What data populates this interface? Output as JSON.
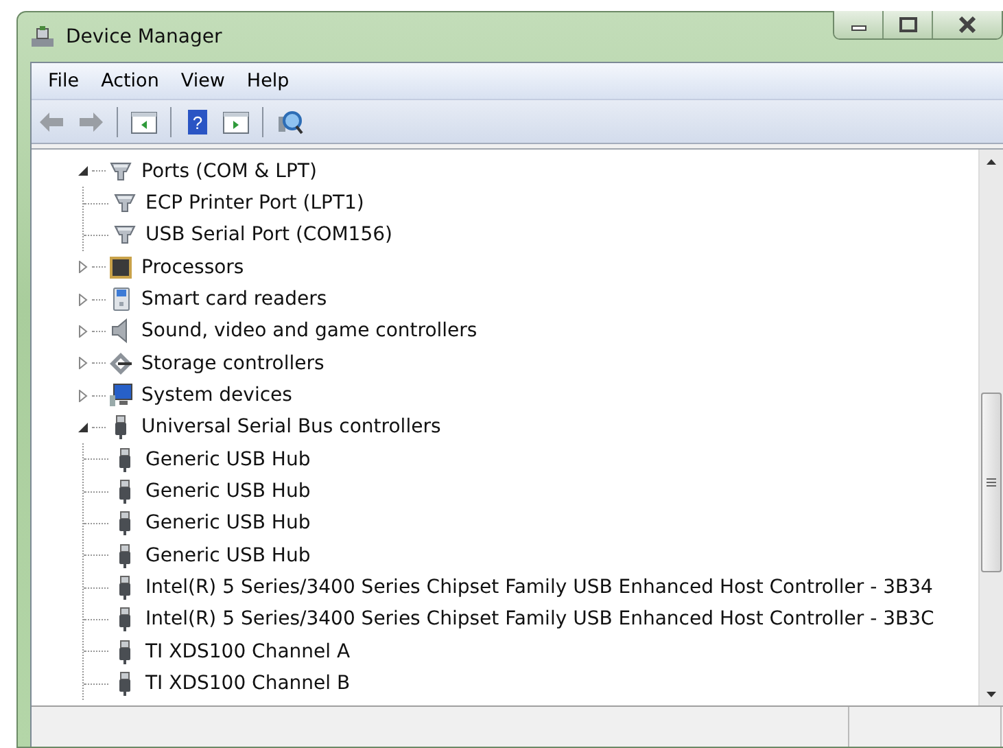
{
  "window": {
    "title": "Device Manager"
  },
  "menu": [
    "File",
    "Action",
    "View",
    "Help"
  ],
  "toolbar": [
    {
      "kind": "back",
      "disabled": true
    },
    {
      "kind": "forward",
      "disabled": true
    },
    {
      "kind": "separator"
    },
    {
      "kind": "console-tree"
    },
    {
      "kind": "separator"
    },
    {
      "kind": "help",
      "glyph": "?"
    },
    {
      "kind": "action-pane"
    },
    {
      "kind": "separator"
    },
    {
      "kind": "scan"
    }
  ],
  "tree": [
    {
      "label": "Ports (COM & LPT)",
      "kind": "port",
      "expanded": true,
      "children": [
        {
          "label": "ECP Printer Port (LPT1)",
          "kind": "port"
        },
        {
          "label": "USB Serial Port (COM156)",
          "kind": "port"
        }
      ]
    },
    {
      "label": "Processors",
      "kind": "processor",
      "expanded": false
    },
    {
      "label": "Smart card readers",
      "kind": "smartcard",
      "expanded": false
    },
    {
      "label": "Sound, video and game controllers",
      "kind": "sound",
      "expanded": false
    },
    {
      "label": "Storage controllers",
      "kind": "storage",
      "expanded": false
    },
    {
      "label": "System devices",
      "kind": "system",
      "expanded": false
    },
    {
      "label": "Universal Serial Bus controllers",
      "kind": "usb",
      "expanded": true,
      "children": [
        {
          "label": "Generic USB Hub",
          "kind": "usb"
        },
        {
          "label": "Generic USB Hub",
          "kind": "usb"
        },
        {
          "label": "Generic USB Hub",
          "kind": "usb"
        },
        {
          "label": "Generic USB Hub",
          "kind": "usb"
        },
        {
          "label": "Intel(R) 5 Series/3400 Series Chipset Family USB Enhanced Host Controller - 3B34",
          "kind": "usb"
        },
        {
          "label": "Intel(R) 5 Series/3400 Series Chipset Family USB Enhanced Host Controller - 3B3C",
          "kind": "usb"
        },
        {
          "label": "TI XDS100 Channel A",
          "kind": "usb"
        },
        {
          "label": "TI XDS100 Channel B",
          "kind": "usb"
        }
      ]
    }
  ]
}
